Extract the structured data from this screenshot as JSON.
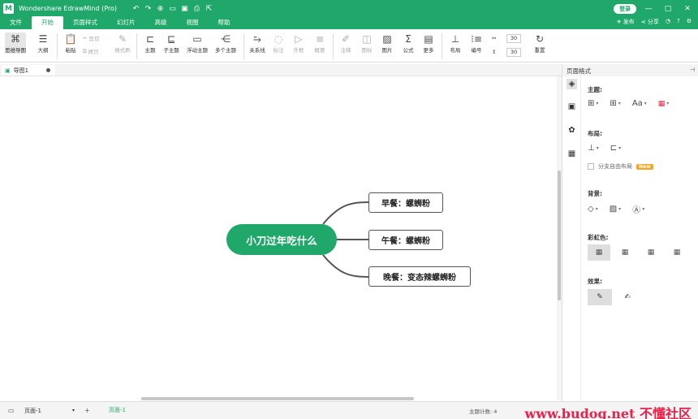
{
  "app": {
    "title": "Wondershare EdrawMind (Pro)",
    "logo": "M",
    "login_label": "登录",
    "window_controls": [
      "—",
      "□",
      "✕"
    ],
    "brand_color": "#1fa86a"
  },
  "menu": {
    "tabs": [
      "文件",
      "开始",
      "页面样式",
      "幻灯片",
      "高级",
      "视图",
      "帮助"
    ],
    "active_tab": "开始",
    "right_items": [
      "发布",
      "分享"
    ]
  },
  "ribbon": {
    "mindmap": "思维导图",
    "outline": "大纲",
    "paste": "粘贴",
    "cut": "剪切",
    "copy": "拷贝",
    "format_painter": "格式刷",
    "topic": "主题",
    "subtopic": "子主题",
    "floating": "浮动主题",
    "multiple": "多个主题",
    "relation": "关系线",
    "callout": "标注",
    "boundary": "外框",
    "summary": "概要",
    "note": "注释",
    "icon": "图标",
    "picture": "图片",
    "formula": "公式",
    "more": "更多",
    "layout": "布局",
    "numbering": "编号",
    "spacing_h": "30",
    "spacing_v": "30",
    "reset": "重置"
  },
  "document": {
    "tab_name": "导图1"
  },
  "mindmap": {
    "central": "小刀过年吃什么",
    "topics": [
      "早餐：螺蛳粉",
      "午餐：螺蛳粉",
      "晚餐：变态辣螺蛳粉"
    ]
  },
  "panel": {
    "title": "页面格式",
    "theme_label": "主题:",
    "theme_font": "Aa",
    "layout_label": "布局:",
    "free_layout": "分支自由布局",
    "new_badge": "New",
    "background_label": "背景:",
    "rainbow_label": "彩虹色:",
    "effects_label": "效果:"
  },
  "status": {
    "page_select": "页面-1",
    "add": "+",
    "page_tab": "页面-1",
    "topic_count": "主题计数: 4",
    "watermark": "www.budog.net 不懂社区"
  }
}
